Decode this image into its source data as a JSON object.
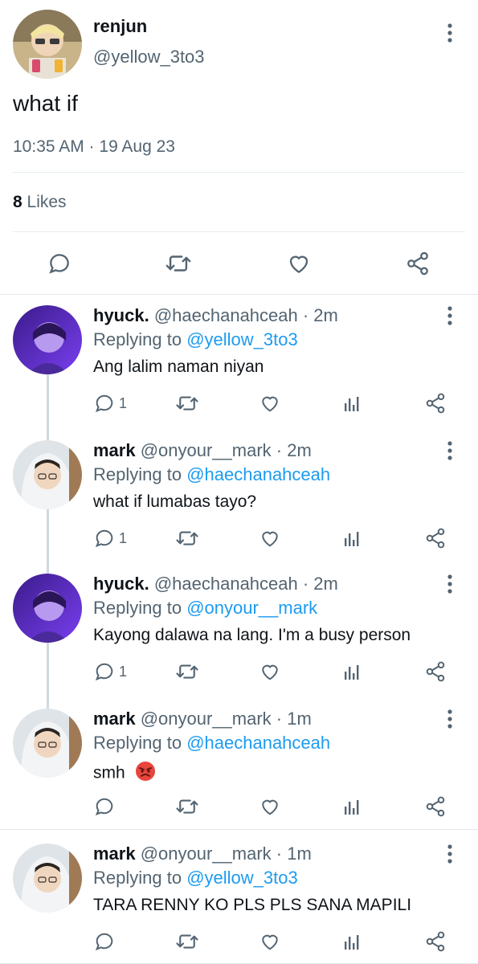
{
  "tweet": {
    "name": "renjun",
    "handle": "@yellow_3to3",
    "text": "what if",
    "timestamp": "10:35 AM · 19 Aug 23",
    "likes_count": "8",
    "likes_label": "Likes",
    "icons": [
      "more-vert-icon",
      "reply-icon",
      "retweet-icon",
      "like-icon",
      "share-icon"
    ]
  },
  "replies": [
    {
      "name": "hyuck.",
      "handle": "@haechanahceah · 2m",
      "replying_label": "Replying to",
      "replying_to": "@yellow_3to3",
      "text": "Ang lalim naman niyan",
      "reply_count": "1"
    },
    {
      "name": "mark",
      "handle": "@onyour__mark · 2m",
      "replying_label": "Replying to",
      "replying_to": "@haechanahceah",
      "text": "what if lumabas tayo?",
      "reply_count": "1"
    },
    {
      "name": "hyuck.",
      "handle": "@haechanahceah · 2m",
      "replying_label": "Replying to",
      "replying_to": "@onyour__mark",
      "text": "Kayong dalawa na lang. I'm a busy person",
      "reply_count": "1"
    },
    {
      "name": "mark",
      "handle": "@onyour__mark · 1m",
      "replying_label": "Replying to",
      "replying_to": "@haechanahceah",
      "text": "smh",
      "reply_count": ""
    },
    {
      "name": "mark",
      "handle": "@onyour__mark · 1m",
      "replying_label": "Replying to",
      "replying_to": "@yellow_3to3",
      "text": "TARA RENNY KO PLS PLS SANA MAPILI",
      "reply_count": ""
    }
  ],
  "colors": {
    "accent": "#1d9bf0",
    "secondary_text": "#536471",
    "thread_line": "#cfd9de",
    "divider": "#e1e8ed"
  }
}
